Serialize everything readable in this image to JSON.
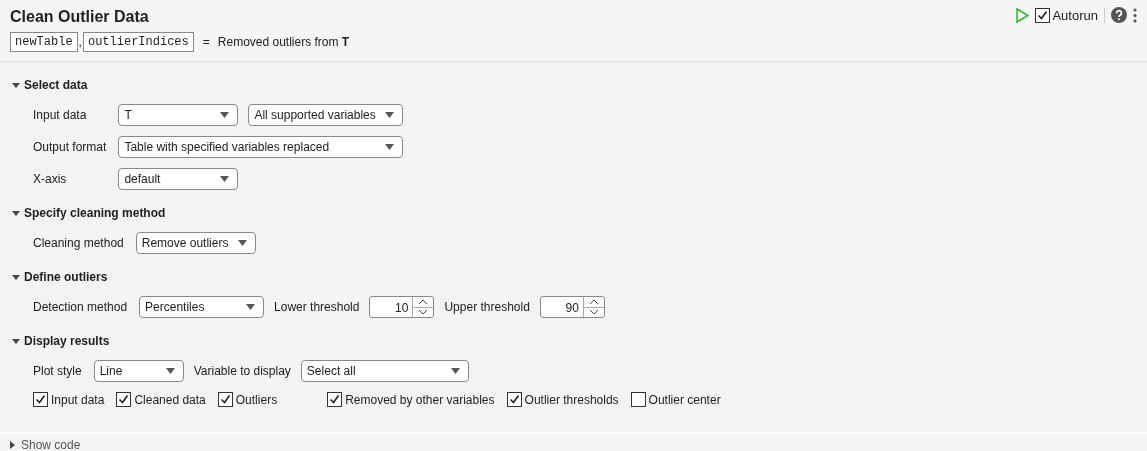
{
  "header": {
    "title": "Clean Outlier Data",
    "outputs": [
      "newTable",
      "outlierIndices"
    ],
    "separator": ",",
    "equals": "=",
    "description": "Removed outliers from **T**"
  },
  "toolbar": {
    "autorun": {
      "label": "Autorun",
      "checked": true
    }
  },
  "sections": [
    {
      "title": "Select data",
      "expanded": true,
      "rows": [
        {
          "items": [
            {
              "kind": "label",
              "text": "Input data"
            },
            {
              "kind": "dropdown",
              "value": "T"
            },
            {
              "kind": "dropdown",
              "value": "All supported variables"
            }
          ]
        },
        {
          "items": [
            {
              "kind": "label",
              "text": "Output format"
            },
            {
              "kind": "dropdown",
              "value": "Table with specified variables replaced"
            }
          ]
        },
        {
          "items": [
            {
              "kind": "label",
              "text": "X-axis"
            },
            {
              "kind": "dropdown",
              "value": "default"
            }
          ]
        }
      ]
    },
    {
      "title": "Specify cleaning method",
      "expanded": true,
      "rows": [
        {
          "items": [
            {
              "kind": "label",
              "text": "Cleaning method"
            },
            {
              "kind": "dropdown",
              "value": "Remove outliers"
            }
          ]
        }
      ]
    },
    {
      "title": "Define outliers",
      "expanded": true,
      "rows": [
        {
          "items": [
            {
              "kind": "label",
              "text": "Detection method"
            },
            {
              "kind": "dropdown",
              "value": "Percentiles"
            },
            {
              "kind": "label",
              "text": "Lower threshold"
            },
            {
              "kind": "spinner",
              "value": "10"
            },
            {
              "kind": "label",
              "text": "Upper threshold"
            },
            {
              "kind": "spinner",
              "value": "90"
            }
          ]
        }
      ]
    },
    {
      "title": "Display results",
      "expanded": true,
      "rows": [
        {
          "items": [
            {
              "kind": "label",
              "text": "Plot style"
            },
            {
              "kind": "dropdown",
              "value": "Line"
            },
            {
              "kind": "label",
              "text": "Variable to display"
            },
            {
              "kind": "dropdown",
              "value": "Select all"
            }
          ]
        },
        {
          "items": [
            {
              "kind": "checkbox",
              "text": "Input data",
              "checked": true
            },
            {
              "kind": "checkbox",
              "text": "Cleaned data",
              "checked": true
            },
            {
              "kind": "checkbox",
              "text": "Outliers",
              "checked": true
            },
            {
              "kind": "checkbox",
              "text": "Removed by other variables",
              "checked": true
            },
            {
              "kind": "checkbox",
              "text": "Outlier thresholds",
              "checked": true
            },
            {
              "kind": "checkbox",
              "text": "Outlier center",
              "checked": false
            }
          ]
        }
      ]
    }
  ],
  "footer": {
    "title": "Show code",
    "expanded": false
  }
}
